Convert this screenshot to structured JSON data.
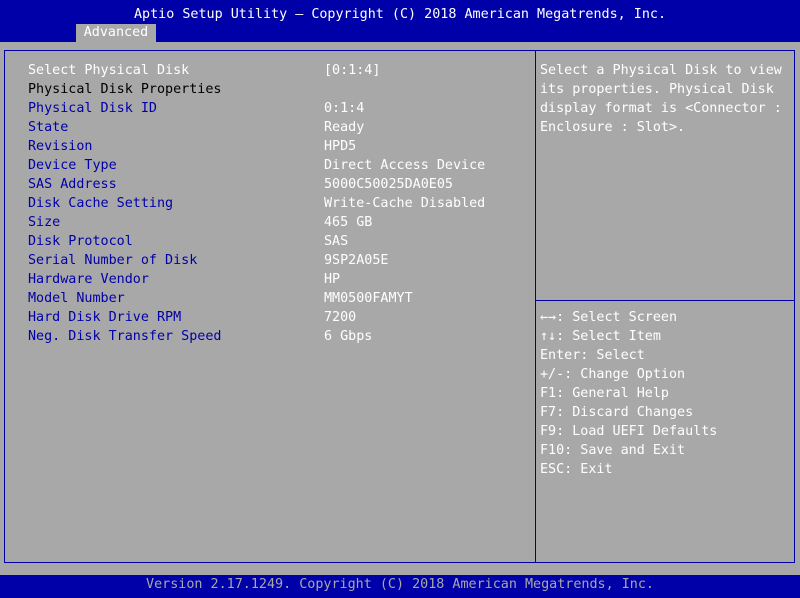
{
  "header": {
    "title": "Aptio Setup Utility – Copyright (C) 2018 American Megatrends, Inc.",
    "active_tab": "Advanced"
  },
  "main": {
    "select_row": {
      "label": "Select Physical Disk",
      "value": "[0:1:4]"
    },
    "section_heading": "Physical Disk Properties",
    "properties": [
      {
        "label": "Physical Disk ID",
        "value": "0:1:4"
      },
      {
        "label": "State",
        "value": "Ready"
      },
      {
        "label": "Revision",
        "value": "HPD5"
      },
      {
        "label": "Device Type",
        "value": "Direct Access Device"
      },
      {
        "label": "SAS Address",
        "value": "5000C50025DA0E05"
      },
      {
        "label": "Disk Cache Setting",
        "value": "Write-Cache Disabled"
      },
      {
        "label": "Size",
        "value": "465 GB"
      },
      {
        "label": "Disk Protocol",
        "value": "SAS"
      },
      {
        "label": "Serial Number of Disk",
        "value": "9SP2A05E"
      },
      {
        "label": "Hardware Vendor",
        "value": "HP"
      },
      {
        "label": "Model Number",
        "value": "MM0500FAMYT"
      },
      {
        "label": "Hard Disk Drive RPM",
        "value": "7200"
      },
      {
        "label": "Neg. Disk Transfer Speed",
        "value": "6 Gbps"
      }
    ]
  },
  "help": {
    "lines": [
      "Select a Physical Disk to view",
      "its properties. Physical Disk",
      "display format is <Connector :",
      "Enclosure : Slot>."
    ]
  },
  "keys": [
    "←→: Select Screen",
    "↑↓: Select Item",
    "Enter: Select",
    "+/-: Change Option",
    "F1: General Help",
    "F7: Discard Changes",
    "F9: Load UEFI Defaults",
    "F10: Save and Exit",
    "ESC: Exit"
  ],
  "footer": {
    "text": "Version 2.17.1249. Copyright (C) 2018 American Megatrends, Inc."
  },
  "colors": {
    "background": "#a8a8a8",
    "bios_blue": "#0000a8",
    "text_white": "#ffffff",
    "text_black": "#000000"
  }
}
